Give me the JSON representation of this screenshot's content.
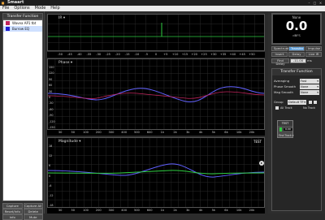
{
  "window": {
    "title": "Smaart",
    "controls": [
      "–",
      "□",
      "×"
    ]
  },
  "menu": [
    "File",
    "Options",
    "Mode",
    "Help"
  ],
  "sidebar": {
    "header": "Transfer Function",
    "items": [
      {
        "label": "Wavea AP1 tbt",
        "color": "#c0245c"
      },
      {
        "label": "Burrow EQ",
        "color": "#1e1ed0"
      }
    ],
    "buttons_row1": [
      "Capture",
      "Capture All"
    ],
    "buttons_row2": [
      "Reset/Info",
      "Delete"
    ],
    "buttons_row3": [
      "Info",
      "Mute"
    ]
  },
  "plots": {
    "ir": {
      "label": "IR ▾",
      "xticks": [
        "-50",
        "-45",
        "-40",
        "-35",
        "-30",
        "-25",
        "-20",
        "-15",
        "-10",
        "-5",
        "0",
        "+5",
        "+10",
        "+15",
        "+20",
        "+25",
        "+30",
        "+35",
        "+40",
        "+45",
        "+50"
      ]
    },
    "phase": {
      "label": "Phase ▾",
      "yticks": [
        "150",
        "120",
        "90",
        "60",
        "30",
        "0",
        "-30",
        "-60",
        "-90",
        "-120",
        "-150"
      ]
    },
    "freq_axis": [
      "30",
      "50",
      "100",
      "200",
      "300",
      "400",
      "500",
      "600",
      "1k",
      "2k",
      "3k",
      "4k",
      "5k",
      "6k",
      "10k",
      "20k"
    ],
    "magnitude": {
      "label": "Magnitude ▾",
      "tag": "TEST",
      "yticks": [
        "18",
        "12",
        "6",
        "0",
        "-6",
        "-12",
        "-18"
      ]
    }
  },
  "meter": {
    "name": "None",
    "value": "0.0",
    "unit": "dBFS"
  },
  "tabs_row1": [
    "Spectrum",
    "Transfer",
    "Impulse"
  ],
  "tabs_row2": [
    "Insert",
    "Delay",
    "Live IR"
  ],
  "delay": {
    "label": "Find Delay",
    "value": "-11.00",
    "unit": "ms"
  },
  "transfer_panel": {
    "title": "Transfer Function",
    "averaging": {
      "label": "Averaging",
      "value": "Fast"
    },
    "phase_smooth": {
      "label": "Phase Smooth",
      "value": "None"
    },
    "mag_smooth": {
      "label": "Mag Smooth",
      "value": "None"
    },
    "group": {
      "label": "Group",
      "value": "Default TF"
    },
    "all_track": "All Track",
    "no_track": "No Track",
    "chip": {
      "name": "TEST",
      "delay": "0.00",
      "footer": "Find   Track   ▾"
    }
  },
  "colors": {
    "magenta": "#c0245c",
    "blue": "#3b3bff",
    "green": "#2ecc40",
    "accent": "#5b9bd5"
  }
}
